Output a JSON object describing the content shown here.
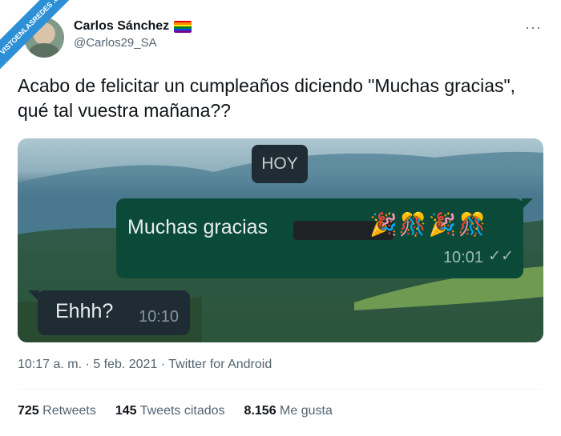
{
  "watermark": "VISTOENLASREDES .com",
  "author": {
    "display_name": "Carlos Sánchez",
    "handle": "@Carlos29_SA",
    "badge_icon": "rainbow-flag-icon"
  },
  "menu": {
    "more_icon": "more-horizontal-icon",
    "label": "···"
  },
  "tweet": {
    "text": "Acabo de felicitar un cumpleaños diciendo \"Muchas gracias\", qué tal vuestra mañana??"
  },
  "chat": {
    "date_chip": "HOY",
    "outgoing": {
      "text": "Muchas gracias",
      "emojis": "🎉🎊🎉🎊",
      "time": "10:01",
      "status_icon": "double-check-icon",
      "status_glyph": "✓✓"
    },
    "incoming": {
      "text": "Ehhh?",
      "time": "10:10"
    }
  },
  "meta": {
    "time": "10:17 a. m.",
    "date": "5 feb. 2021",
    "source": "Twitter for Android",
    "separator": " · "
  },
  "stats": {
    "retweets_count": "725",
    "retweets_label": "Retweets",
    "quotes_count": "145",
    "quotes_label": "Tweets citados",
    "likes_count": "8.156",
    "likes_label": "Me gusta"
  },
  "colors": {
    "text": "#0f1419",
    "secondary": "#536471",
    "outgoing_bubble": "#0b4a39",
    "incoming_bubble": "#1f2c34"
  }
}
